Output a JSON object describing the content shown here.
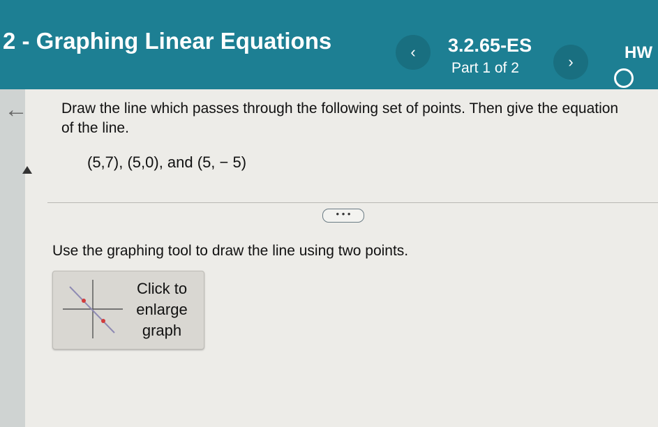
{
  "header": {
    "assignment_title": "2 - Graphing Linear Equations",
    "problem_id": "3.2.65-ES",
    "part_indicator": "Part 1 of 2",
    "hw_label": "HW",
    "prev_icon": "‹",
    "next_icon": "›"
  },
  "question": {
    "prompt": "Draw the line which passes through the following set of points. Then give the equation of the line.",
    "points": "(5,7), (5,0), and (5, − 5)"
  },
  "more_button": {
    "label": "• • •"
  },
  "instruction": "Use the graphing tool to draw the line using two points.",
  "graph_button": {
    "label_line1": "Click to",
    "label_line2": "enlarge",
    "label_line3": "graph"
  },
  "icons": {
    "back": "left-arrow-icon",
    "prev": "chevron-left-icon",
    "next": "chevron-right-icon",
    "status": "circle-icon",
    "collapse": "triangle-up-icon",
    "thumbnail": "graph-thumbnail-icon"
  },
  "colors": {
    "header_bg": "#1d7f93",
    "accent_point": "#d23c3c",
    "line_color": "#8e8ab3"
  }
}
